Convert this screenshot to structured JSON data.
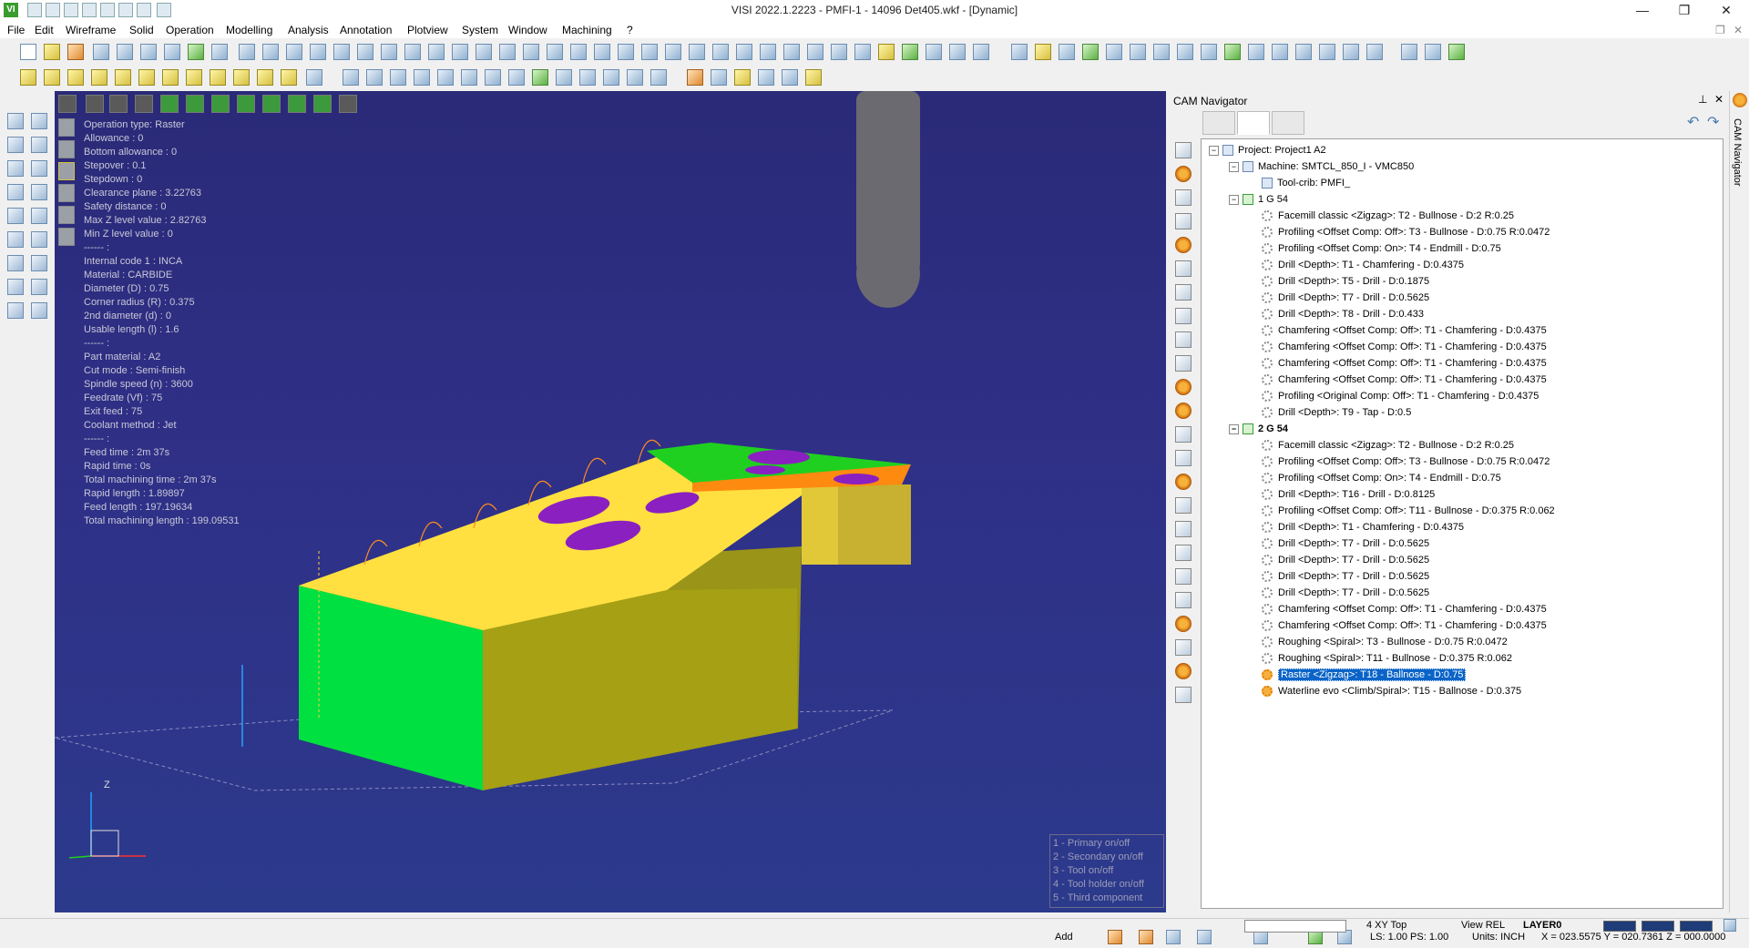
{
  "window": {
    "title": "VISI 2022.1.2223 - PMFI-1 - 14096 Det405.wkf - [Dynamic]",
    "app_icon": "VI",
    "minimize": "—",
    "maximize": "❐",
    "close": "✕"
  },
  "menu": [
    "File",
    "Edit",
    "Wireframe",
    "Solid",
    "Operation",
    "Modelling",
    "Analysis",
    "Annotation",
    "Plotview",
    "System",
    "Window",
    "Machining",
    "?"
  ],
  "operation_info": [
    "Operation type: Raster",
    "Allowance : 0",
    "Bottom allowance : 0",
    "Stepover : 0.1",
    "Stepdown : 0",
    "Clearance plane : 3.22763",
    "Safety distance : 0",
    "Max Z level value : 2.82763",
    "Min Z level value : 0",
    "------ :",
    "Internal code 1 : INCA",
    "Material : CARBIDE",
    "Diameter (D) : 0.75",
    "Corner radius (R) : 0.375",
    "2nd diameter (d) : 0",
    "Usable length (l) : 1.6",
    "------ :",
    "Part material : A2",
    "Cut mode : Semi-finish",
    "Spindle speed (n) : 3600",
    "Feedrate (Vf) : 75",
    "Exit feed : 75",
    "Coolant method : Jet",
    "------ :",
    "Feed time : 2m 37s",
    "Rapid time : 0s",
    "Total machining time : 2m 37s",
    "Rapid length : 1.89897",
    "Feed length : 197.19634",
    "Total machining length : 199.09531"
  ],
  "axis": {
    "z_label": "Z"
  },
  "simulation_legend": [
    "1 - Primary on/off",
    "2 - Secondary on/off",
    "3 - Tool on/off",
    "4 - Tool holder on/off",
    "5 - Third component"
  ],
  "cam_navigator": {
    "title": "CAM Navigator",
    "pin": "⊥",
    "close": "✕",
    "vertical_tab": "CAM Navigator",
    "tree": {
      "project": "Project: Project1 A2",
      "machine": "Machine: SMTCL_850_I - VMC850",
      "toolcrib": "Tool-crib: PMFI_",
      "setup1": {
        "label": "1 G 54",
        "operations": [
          "Facemill classic <Zigzag>: T2 - Bullnose - D:2 R:0.25",
          "Profiling <Offset Comp: Off>: T3 - Bullnose - D:0.75 R:0.0472",
          "Profiling <Offset Comp: On>: T4 - Endmill - D:0.75",
          "Drill <Depth>: T1 - Chamfering - D:0.4375",
          "Drill <Depth>: T5 - Drill - D:0.1875",
          "Drill <Depth>: T7 - Drill - D:0.5625",
          "Drill <Depth>: T8 - Drill - D:0.433",
          "Chamfering <Offset Comp: Off>: T1 - Chamfering - D:0.4375",
          "Chamfering <Offset Comp: Off>: T1 - Chamfering - D:0.4375",
          "Chamfering <Offset Comp: Off>: T1 - Chamfering - D:0.4375",
          "Chamfering <Offset Comp: Off>: T1 - Chamfering - D:0.4375",
          "Profiling <Original Comp: Off>: T1 - Chamfering - D:0.4375",
          "Drill <Depth>: T9 - Tap - D:0.5"
        ]
      },
      "setup2": {
        "label": "2 G 54",
        "operations": [
          "Facemill classic <Zigzag>: T2 - Bullnose - D:2 R:0.25",
          "Profiling <Offset Comp: Off>: T3 - Bullnose - D:0.75 R:0.0472",
          "Profiling <Offset Comp: On>: T4 - Endmill - D:0.75",
          "Drill <Depth>: T16 - Drill - D:0.8125",
          "Profiling <Offset Comp: Off>: T11 - Bullnose - D:0.375 R:0.062",
          "Drill <Depth>: T1 - Chamfering - D:0.4375",
          "Drill <Depth>: T7 - Drill - D:0.5625",
          "Drill <Depth>: T7 - Drill - D:0.5625",
          "Drill <Depth>: T7 - Drill - D:0.5625",
          "Drill <Depth>: T7 - Drill - D:0.5625",
          "Chamfering <Offset Comp: Off>: T1 - Chamfering - D:0.4375",
          "Chamfering <Offset Comp: Off>: T1 - Chamfering - D:0.4375",
          "Roughing <Spiral>: T3 - Bullnose - D:0.75 R:0.0472",
          "Roughing <Spiral>: T11 - Bullnose - D:0.375 R:0.062",
          "Raster <Zigzag>: T18 - Ballnose - D:0.75",
          "Waterline evo <Climb/Spiral>: T15 - Ballnose - D:0.375"
        ]
      }
    }
  },
  "status": {
    "add": "Add",
    "view_name": "4 XY Top",
    "view_mode": "View REL",
    "layer": "LAYER0",
    "scale": "LS: 1.00 PS: 1.00",
    "units": "Units: INCH",
    "coords": "X = 023.5575 Y = 020.7361 Z = 000.0000"
  }
}
